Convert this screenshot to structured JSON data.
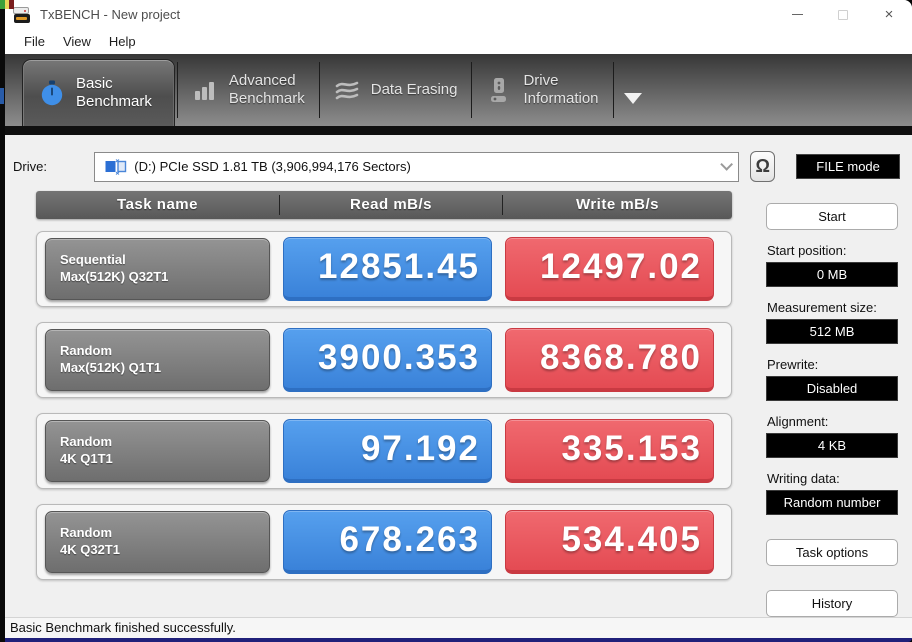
{
  "window": {
    "title": "TxBENCH - New project"
  },
  "menu": {
    "file": "File",
    "view": "View",
    "help": "Help"
  },
  "tabs": {
    "basic": {
      "line1": "Basic",
      "line2": "Benchmark"
    },
    "advanced": {
      "line1": "Advanced",
      "line2": "Benchmark"
    },
    "erasing": {
      "label": "Data Erasing"
    },
    "drive_info": {
      "line1": "Drive",
      "line2": "Information"
    }
  },
  "drive": {
    "label": "Drive:",
    "selected": "(D:) PCIe SSD  1.81 TB (3,906,994,176 Sectors)",
    "refresh_glyph": "Ω",
    "mode_badge": "FILE mode"
  },
  "table": {
    "headers": {
      "task": "Task name",
      "read": "Read mB/s",
      "write": "Write mB/s"
    },
    "rows": [
      {
        "name1": "Sequential",
        "name2": "Max(512K) Q32T1",
        "read": "12851.45",
        "write": "12497.02"
      },
      {
        "name1": "Random",
        "name2": "Max(512K) Q1T1",
        "read": "3900.353",
        "write": "8368.780"
      },
      {
        "name1": "Random",
        "name2": "4K Q1T1",
        "read": "97.192",
        "write": "335.153"
      },
      {
        "name1": "Random",
        "name2": "4K Q32T1",
        "read": "678.263",
        "write": "534.405"
      }
    ]
  },
  "sidebar": {
    "start": "Start",
    "fields": [
      {
        "label": "Start position:",
        "value": "0 MB"
      },
      {
        "label": "Measurement size:",
        "value": "512 MB"
      },
      {
        "label": "Prewrite:",
        "value": "Disabled"
      },
      {
        "label": "Alignment:",
        "value": "4 KB"
      },
      {
        "label": "Writing data:",
        "value": "Random number"
      }
    ],
    "task_options": "Task options",
    "history": "History"
  },
  "statusbar": {
    "message": "Basic Benchmark finished successfully."
  },
  "colors": {
    "value_blue": "#3a82d9",
    "value_red": "#e44b53",
    "accent_stopwatch": "#3f8fe8",
    "navy_border": "#20207a"
  }
}
